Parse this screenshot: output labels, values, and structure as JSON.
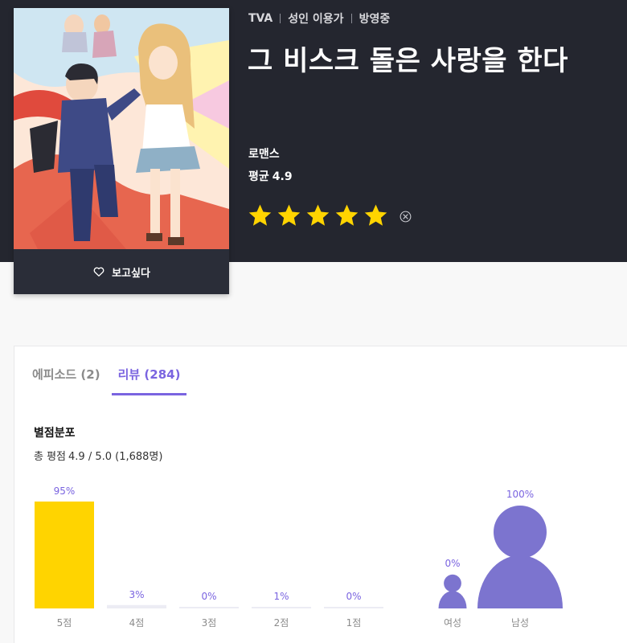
{
  "show": {
    "meta": [
      "TVA",
      "성인 이용가",
      "방영중"
    ],
    "title": "그 비스크 돌은 사랑을 한다",
    "genre": "로맨스",
    "avg_label": "평균",
    "avg_value": "4.9",
    "wish_label": "보고싶다",
    "star_rating": 5
  },
  "tabs": [
    {
      "label": "에피소드 (2)",
      "active": false
    },
    {
      "label": "리뷰 (284)",
      "active": true
    }
  ],
  "distribution": {
    "title": "별점분포",
    "summary_label": "총 평점",
    "summary_value": "4.9 / 5.0 (1,688명)"
  },
  "chart_data": [
    {
      "type": "bar",
      "categories": [
        "5점",
        "4점",
        "3점",
        "2점",
        "1점"
      ],
      "values": [
        95,
        3,
        0,
        1,
        0
      ],
      "data_labels": [
        "95%",
        "3%",
        "0%",
        "1%",
        "0%"
      ],
      "unit": "%",
      "colors": {
        "highlight": "#ffd400",
        "normal": "#ececf4",
        "label": "#7a64e0"
      }
    },
    {
      "type": "bar",
      "categories": [
        "여성",
        "남성"
      ],
      "values": [
        0,
        100
      ],
      "data_labels": [
        "0%",
        "100%"
      ],
      "unit": "%",
      "marker": "person-icon",
      "colors": {
        "fill": "#7c74cf",
        "label": "#7a64e0"
      }
    }
  ],
  "colors": {
    "hero_bg": "#24262f",
    "accent": "#7a64e0",
    "star": "#ffd400"
  }
}
